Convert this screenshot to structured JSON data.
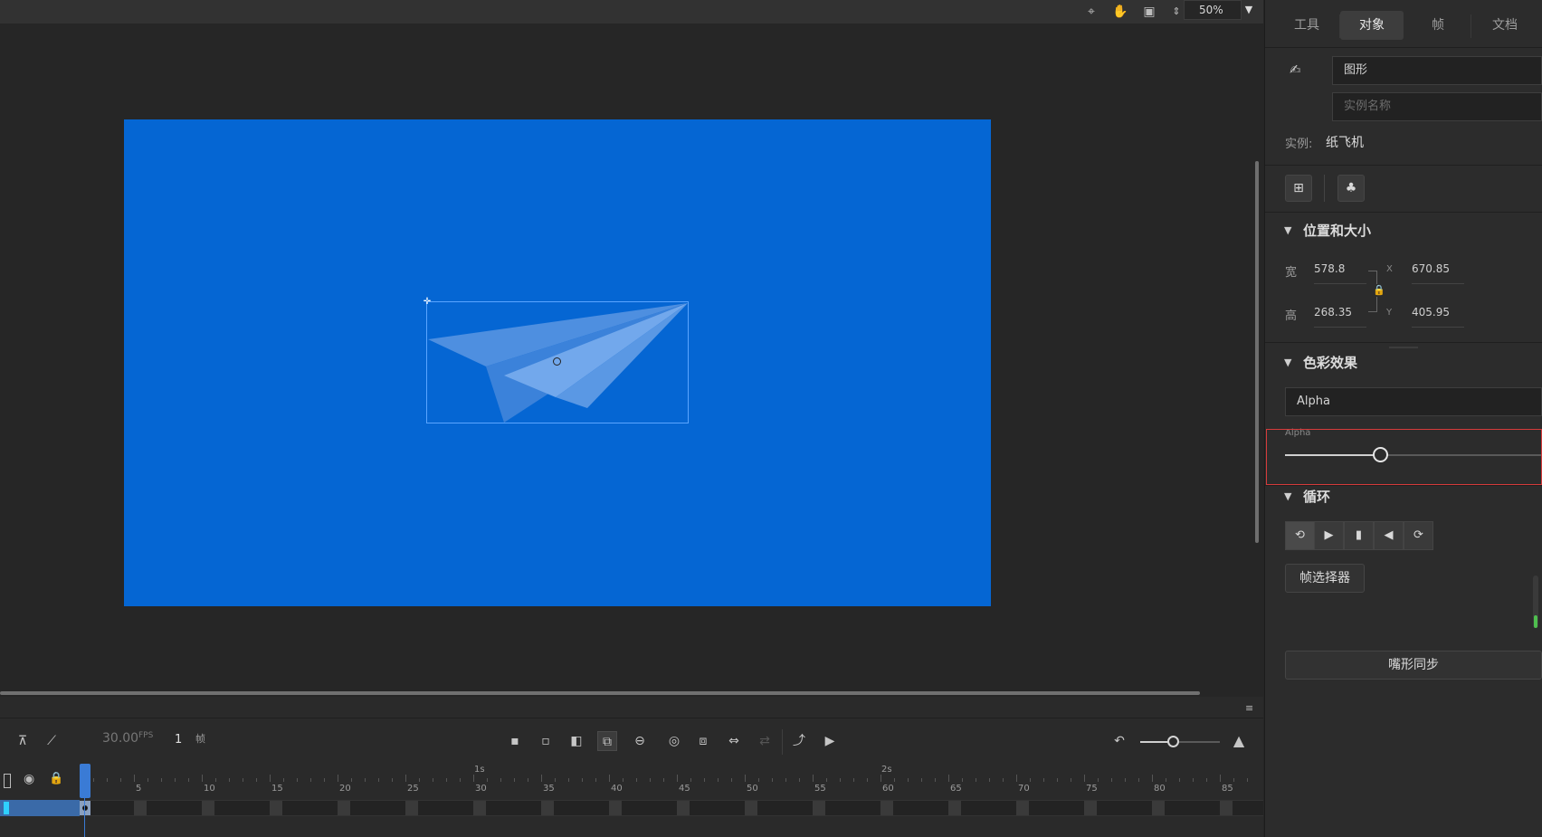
{
  "toolbar": {
    "zoom": "50%",
    "icons": [
      "crosshair-icon",
      "hand-icon",
      "fit-icon",
      "stepper-icon"
    ]
  },
  "panel": {
    "tabs": [
      {
        "label": "工具",
        "active": false
      },
      {
        "label": "对象",
        "active": true
      },
      {
        "label": "帧",
        "active": false
      },
      {
        "label": "文档",
        "active": false
      }
    ],
    "symbol_type": "图形",
    "instance_name_placeholder": "实例名称",
    "instance_label": "实例:",
    "instance_value": "纸飞机",
    "position_section": "位置和大小",
    "width_label": "宽",
    "width_value": "578.8",
    "height_label": "高",
    "height_value": "268.35",
    "x_label": "X",
    "x_value": "670.85",
    "y_label": "Y",
    "y_value": "405.95",
    "color_section": "色彩效果",
    "color_mode": "Alpha",
    "alpha_label": "Alpha",
    "alpha_fraction": 0.37,
    "loop_section": "循环",
    "frame_picker": "帧选择器",
    "lip_sync": "嘴形同步"
  },
  "timeline": {
    "fps": "30.00",
    "fps_unit": "FPS",
    "current_frame": "1",
    "frame_unit": "帧",
    "ruler_labels": [
      "5",
      "10",
      "15",
      "20",
      "25",
      "30",
      "35",
      "40",
      "45",
      "50",
      "55",
      "60",
      "65",
      "70",
      "75",
      "80",
      "85"
    ],
    "second_labels": [
      "1s",
      "2s"
    ]
  },
  "colors": {
    "stage": "#0566d3",
    "accent": "#3a7bd5",
    "highlight": "#d63b3b"
  }
}
